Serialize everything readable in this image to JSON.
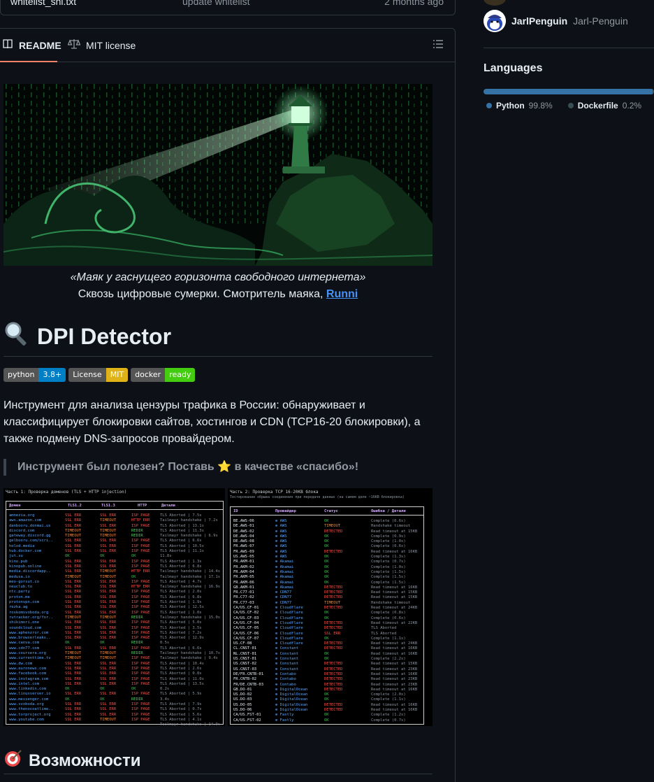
{
  "file_row": {
    "name": "whitelist_sni.txt",
    "message": "update whitelist",
    "time": "2 months ago"
  },
  "tabs": {
    "readme": "README",
    "license": "MIT license"
  },
  "hero": {
    "caption_italic": "«Маяк у гаснущего горизонта свободного интернета»",
    "caption_text": "Сквозь цифровые сумерки. Смотритель маяка,",
    "caption_link": "Runni"
  },
  "title": "DPI Detector",
  "badges": [
    {
      "label": "python",
      "value": "3.8+",
      "color": "#007ec6"
    },
    {
      "label": "License",
      "value": "MIT",
      "color": "#dfb317"
    },
    {
      "label": "docker",
      "value": "ready",
      "color": "#4c1"
    }
  ],
  "description": "Инструмент для анализа цензуры трафика в России: обнаруживает и классифицирует блокировки сайтов, хостингов и CDN (TCP16-20 блокировки), а также подмену DNS-запросов провайдером.",
  "quote": "Инструмент был полезен? Поставь ⭐ в качестве «спасибо»!",
  "screenshot_left": {
    "title": "Часть 1: Проверка доменов (TLS + HTTP injection)",
    "headers": [
      "Домен",
      "TLS1.2",
      "TLS1.3",
      "HTTP",
      "Детали"
    ],
    "domains": [
      "amnezia.org",
      "aws.amazon.com",
      "danbooru.donmai.us",
      "discord.com",
      "gateway.discord.gg",
      "gelbooru.com/scri..",
      "holod.media",
      "hub.docker.com",
      "jut.su",
      "kino.pub",
      "kinopub.online",
      "media.discordapp..",
      "medusa.io",
      "meo-gorsut.co",
      "neuclub.to",
      "ntc.party",
      "proton.me",
      "protonvpn.com",
      "rezka.ag",
      "roskomsvoboda.org",
      "rutracker.org/for..",
      "shikimori.one",
      "soundcloud.com",
      "www.aphenzror.com",
      "www.browserleaks..",
      "www.canva.com",
      "www.cdn77.com",
      "www.coursera.org",
      "www.currenttime.tv",
      "www.dw.com",
      "www.euronews.com",
      "www.facebook.com",
      "www.instagram.com",
      "www.intel.com",
      "www.linkedin.com",
      "www.linuxserver.io",
      "www.messenger.com",
      "www.svoboda.org",
      "www.thenocoatlime..",
      "www.torproject.org",
      "www.youtube.com"
    ],
    "tls12": [
      "SSL ERR",
      "SSL ERR",
      "SSL ERR",
      "TIMEOUT",
      "TIMEOUT",
      "SSL ERR",
      "SSL ERR",
      "SSL ERR",
      "OK",
      "SSL ERR",
      "SSL ERR",
      "SSL ERR",
      "TIMEOUT",
      "SSL ERR",
      "SSL ERR",
      "SSL ERR",
      "SSL ERR",
      "SSL ERR",
      "SSL ERR",
      "SSL ERR",
      "TIMEOUT",
      "SSL ERR",
      "SSL ERR",
      "SSL ERR",
      "SSL ERR",
      "OK",
      "SSL ERR",
      "TIMEOUT",
      "TIMEOUT",
      "SSL ERR",
      "SSL ERR",
      "SSL ERR",
      "SSL ERR",
      "SSL ERR",
      "OK",
      "SSL ERR",
      "OK",
      "SSL ERR",
      "SSL ERR",
      "SSL ERR",
      "SSL ERR"
    ],
    "tls13": [
      "SSL ERR",
      "TIMEOUT",
      "SSL ERR",
      "TIMEOUT",
      "TIMEOUT",
      "SSL ERR",
      "SSL ERR",
      "SSL ERR",
      "OK",
      "SSL ERR",
      "SSL ERR",
      "TIMEOUT",
      "TIMEOUT",
      "SSL ERR",
      "SSL ERR",
      "SSL ERR",
      "SSL ERR",
      "SSL ERR",
      "SSL ERR",
      "SSL ERR",
      "TIMEOUT",
      "SSL ERR",
      "SSL ERR",
      "SSL ERR",
      "SSL ERR",
      "OK",
      "SSL ERR",
      "TIMEOUT",
      "TIMEOUT",
      "SSL ERR",
      "SSL ERR",
      "SSL ERR",
      "SSL ERR",
      "SSL ERR",
      "OK",
      "SSL ERR",
      "OK",
      "SSL ERR",
      "SSL ERR",
      "SSL ERR",
      "TIMEOUT"
    ],
    "http": [
      "ISP PAGE",
      "HTTP ERR",
      "ISP PAGE",
      "REDIR",
      "REDIR",
      "ISP PAGE",
      "ISP PAGE",
      "ISP PAGE",
      "OK",
      "ISP PAGE",
      "ISP PAGE",
      "HTTP ERR",
      "OK",
      "ISP PAGE",
      "HTTP ERR",
      "ISP PAGE",
      "ISP PAGE",
      "ISP PAGE",
      "ISP PAGE",
      "ISP PAGE",
      "REDIR",
      "ISP PAGE",
      "ISP PAGE",
      "ISP PAGE",
      "ISP PAGE",
      "REDIR",
      "ISP PAGE",
      "REDIR",
      "ISP PAGE",
      "ISP PAGE",
      "ISP PAGE",
      "ISP PAGE",
      "ISP PAGE",
      "ISP PAGE",
      "OK",
      "ISP PAGE",
      "REDIR",
      "ISP PAGE",
      "ISP PAGE",
      "ISP PAGE",
      "ISP PAGE"
    ],
    "details": [
      "TLS Aborted | 7.5s",
      "Tailmayr handshake | 7.2s",
      "TLS Aborted | 13.1s",
      "TLS Aborted | 11.3s",
      "Tailmayr handshake | 6.9s",
      "TLS Aborted | 6.6s",
      "TLS Aborted | 10.5s",
      "TLS Aborted | 11.1s",
      "11.8s",
      "TLS Aborted | 1.3s",
      "TLS Aborted | 6.8s",
      "Tailmayr handshake | 14.4s",
      "Tailmayr handshake | 17.1s",
      "TLS Aborted | 4.7s",
      "Tailmayr handshake | 16.9s",
      "TLS Aborted | 2.0s",
      "TLS Aborted | 6.8s",
      "TLS Aborted | 1.9s",
      "TLS Aborted | 12.5s",
      "TLS Aborted | 1.0s",
      "Tailmayr handshake | 15.0s",
      "TLS Aborted | 5.0s",
      "TLS Aborted | 3.5s",
      "TLS Aborted | 7.2s",
      "TLS Aborted | 12.9s",
      "0.5s",
      "TLS Aborted | 6.6s",
      "Tailmayr handshake | 10.7s",
      "Tailmayr handshake | 9.4s",
      "TLS Aborted | 10.4s",
      "TLS Aborted | 2.6s",
      "TLS Aborted | 0.8s",
      "TLS Aborted | 11.0s",
      "TLS Aborted | 13.5s",
      "0.2s",
      "TLS Aborted | 5.9s",
      "3.4s",
      "TLS Aborted | 7.9s",
      "TLS Aborted | 0.7s",
      "TLS Aborted | 5.6s",
      "TLS Aborted | 4.1s",
      "Tailmayr handshake | 14.9s"
    ]
  },
  "screenshot_right": {
    "title": "Часть 2: Проверка TCP 16-20KB блока",
    "subtitle": "Тестирование обрыва соединения при передаче данных (на самом деле ~16KB блокировка)",
    "headers": [
      "ID",
      "Провайдер",
      "Статус",
      "Ошибка / Детали"
    ],
    "ids": [
      "BE.AWS-06",
      "DE.AWS-01",
      "DE.AWS-02",
      "DE.AWS-04",
      "DE.AWS-08",
      "FR.AWS-07",
      "FR.AWS-09",
      "US.AWS-05",
      "FR.AKM-01",
      "FR.AKM-02",
      "FR.AKM-04",
      "FR.AKM-05",
      "FR.AKM-06",
      "GB.AKM-01",
      "FR.C77-01",
      "FR.C77-02",
      "FR.C77-03",
      "CA/US.CF-01",
      "CA/US.CF-02",
      "CA/US.CF-03",
      "CA/US.CF-04",
      "CA/US.CF-05",
      "CA/US.CF-06",
      "CA/US.CF-07",
      "US.CF-08",
      "CL.CNST-01",
      "NL.CNST-01",
      "US.CNST-01",
      "US.CNST-02",
      "US.CNST-03",
      "DE/FR.CNTB-01",
      "FR.CNTB-02",
      "FR/DE.CNTB-03",
      "GB.DO-01",
      "US.DO-02",
      "US.DO-03",
      "US.DO-05",
      "US.DO-06",
      "CA/US.FST-01",
      "CA/US.FST-02"
    ],
    "providers": [
      "AWS",
      "AWS",
      "AWS",
      "AWS",
      "AWS",
      "AWS",
      "AWS",
      "AWS",
      "Akamai",
      "Akamai",
      "Akamai",
      "Akamai",
      "Akamai",
      "Akamai",
      "CDN77",
      "CDN77",
      "CDN77",
      "Cloudflare",
      "Cloudflare",
      "Cloudflare",
      "Cloudflare",
      "Cloudflare",
      "Cloudflare",
      "Cloudflare",
      "Cloudflare",
      "Constant",
      "Constant",
      "Constant",
      "Constant",
      "Constant",
      "Contabo",
      "Contabo",
      "Contabo",
      "DigitalOcean",
      "DigitalOcean",
      "DigitalOcean",
      "DigitalOcean",
      "DigitalOcean",
      "Fastly",
      "Fastly"
    ],
    "statuses": [
      "OK",
      "TIMEOUT",
      "DETECTED",
      "OK",
      "OK",
      "OK",
      "DETECTED",
      "OK",
      "OK",
      "OK",
      "OK",
      "OK",
      "OK",
      "DETECTED",
      "DETECTED",
      "DETECTED",
      "TIMEOUT",
      "DETECTED",
      "OK",
      "OK",
      "DETECTED",
      "DETECTED",
      "SSL ERR",
      "OK",
      "DETECTED",
      "DETECTED",
      "OK",
      "OK",
      "DETECTED",
      "DETECTED",
      "DETECTED",
      "DETECTED",
      "DETECTED",
      "DETECTED",
      "OK",
      "OK",
      "DETECTED",
      "DETECTED",
      "OK",
      "OK"
    ],
    "details": [
      "Complete (0.6s)",
      "Handshake timeout",
      "Read timeout at 15KB",
      "Complete (0.9s)",
      "Complete (1.0s)",
      "Complete (0.6s)",
      "Read timeout at 16KB",
      "Complete (1.3s)",
      "Complete (0.7s)",
      "Complete (1.0s)",
      "Complete (1.5s)",
      "Complete (1.5s)",
      "Complete (1.5s)",
      "Read timeout at 16KB",
      "Read timeout at 15KB",
      "Read timeout at 15KB",
      "Handshake timeout",
      "Read timeout at 24KB",
      "Complete (0.8s)",
      "Complete (0.6s)",
      "Read timeout at 22KB",
      "TLS Aborted",
      "TLS Aborted",
      "Complete (1.1s)",
      "Read timeout at 24KB",
      "Read timeout at 16KB",
      "Read timeout at 16KB",
      "Complete (2.2s)",
      "Read timeout at 15KB",
      "Read timeout at 23KB",
      "Read timeout at 16KB",
      "Read timeout at 23KB",
      "Read timeout at 23KB",
      "Read timeout at 16KB",
      "Complete (2.0s)",
      "Complete (1.1s)",
      "Read timeout at 16KB",
      "Read timeout at 16KB",
      "Complete (1.2s)",
      "Complete (0.7s)"
    ]
  },
  "section_title": "Возможности",
  "sidebar": {
    "contributor_name": "JarlPenguin",
    "contributor_handle": "Jarl-Penguin",
    "languages_title": "Languages",
    "languages": [
      {
        "name": "Python",
        "percent": "99.8%",
        "color": "#3572a5",
        "share": 99.8
      },
      {
        "name": "Dockerfile",
        "percent": "0.2%",
        "color": "#384d54",
        "share": 0.2
      }
    ]
  },
  "colors": {
    "ok": "#3fb950",
    "err": "#f85149",
    "timeout": "#f0883e",
    "redir": "#56d364",
    "accent": "#f78166"
  }
}
